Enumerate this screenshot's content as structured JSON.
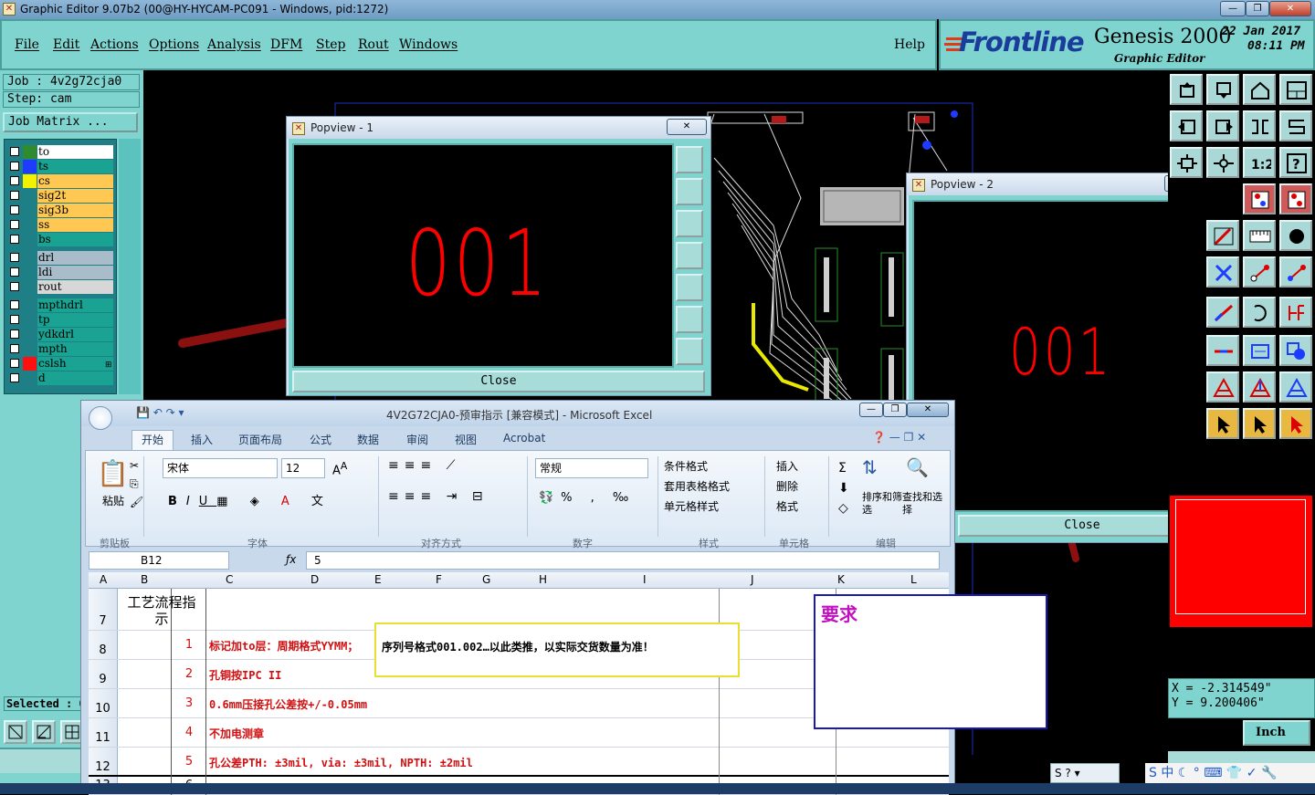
{
  "window": {
    "title": "Graphic Editor 9.07b2 (00@HY-HYCAM-PC091 - Windows, pid:1272)",
    "controls": [
      "—",
      "❐",
      "✕"
    ]
  },
  "menu": [
    "File",
    "Edit",
    "Actions",
    "Options",
    "Analysis",
    "DFM",
    "Step",
    "Rout",
    "Windows"
  ],
  "help": "Help",
  "brand": {
    "logo": "Frontline",
    "product": "Genesis 2000",
    "subtitle": "Graphic Editor",
    "date": "22 Jan 2017",
    "time": "08:11 PM"
  },
  "job": {
    "job_label": "Job : 4v2g72cja0",
    "step_label": "Step: cam",
    "matrix_button": "Job Matrix ..."
  },
  "layers": [
    {
      "name": "to",
      "swatch": "#2e8b2e",
      "bg": "#ffffff"
    },
    {
      "name": "ts",
      "swatch": "#1e3cff",
      "bg": "#1aa392"
    },
    {
      "name": "cs",
      "swatch": "#f2f200",
      "bg": "#ffc852"
    },
    {
      "name": "sig2t",
      "swatch": "",
      "bg": "#ffc852"
    },
    {
      "name": "sig3b",
      "swatch": "",
      "bg": "#ffc852"
    },
    {
      "name": "ss",
      "swatch": "",
      "bg": "#ffc852"
    },
    {
      "name": "bs",
      "swatch": "",
      "bg": "#1aa392"
    },
    {
      "name": "drl",
      "swatch": "",
      "bg": "#a9bcc9"
    },
    {
      "name": "ldi",
      "swatch": "",
      "bg": "#a9bcc9"
    },
    {
      "name": "rout",
      "swatch": "",
      "bg": "#d7d7d7"
    },
    {
      "name": "mpthdrl",
      "swatch": "",
      "bg": "#1aa392"
    },
    {
      "name": "tp",
      "swatch": "",
      "bg": "#1aa392"
    },
    {
      "name": "ydkdrl",
      "swatch": "",
      "bg": "#1aa392"
    },
    {
      "name": "mpth",
      "swatch": "",
      "bg": "#1aa392"
    },
    {
      "name": "cslsh",
      "swatch": "#ff1010",
      "bg": "#1aa392"
    },
    {
      "name": "d",
      "swatch": "",
      "bg": "#1aa392"
    }
  ],
  "selected_label": "Selected : 0",
  "popview1": {
    "title": "Popview - 1",
    "value": "001",
    "close": "Close"
  },
  "popview2": {
    "title": "Popview - 2",
    "value": "001",
    "close": "Close"
  },
  "coords": {
    "x": "X = -2.314549\"",
    "y": "Y = 9.200406\""
  },
  "unit_button": "Inch",
  "excel": {
    "title": "4V2G72CJA0-预审指示 [兼容模式] - Microsoft Excel",
    "tabs": [
      "开始",
      "插入",
      "页面布局",
      "公式",
      "数据",
      "审阅",
      "视图",
      "Acrobat"
    ],
    "groups": [
      "剪贴板",
      "字体",
      "对齐方式",
      "数字",
      "样式",
      "单元格",
      "编辑"
    ],
    "paste": "粘贴",
    "font_name": "宋体",
    "font_size": "12",
    "number_format": "常规",
    "styles": [
      "条件格式",
      "套用表格格式",
      "单元格样式"
    ],
    "cells_ops": [
      "插入",
      "删除",
      "格式"
    ],
    "editing": [
      "排序和筛选",
      "查找和选择"
    ],
    "name_box": "B12",
    "formula_value": "5",
    "columns": [
      "A",
      "B",
      "C",
      "D",
      "E",
      "F",
      "G",
      "H",
      "I",
      "J",
      "K",
      "L"
    ],
    "header_cell": "工艺流程指示",
    "rows": [
      {
        "num": "7",
        "b": "",
        "text": ""
      },
      {
        "num": "8",
        "b": "1",
        "text": "标记加to层：周期格式YYMM；"
      },
      {
        "num": "9",
        "b": "2",
        "text": "孔铜按IPC II"
      },
      {
        "num": "10",
        "b": "3",
        "text": "0.6mm压接孔公差按+/-0.05mm"
      },
      {
        "num": "11",
        "b": "4",
        "text": "不加电测章"
      },
      {
        "num": "12",
        "b": "5",
        "text": "孔公差PTH: ±3mil,  via: ±3mil,  NPTH: ±2mil"
      },
      {
        "num": "13",
        "b": "6",
        "text": ""
      }
    ],
    "callout": "序列号格式001.002…以此类推，以实际交货数量为准！",
    "note_title": "要求"
  },
  "colors": {
    "teal": "#7fd4d0",
    "red": "#ff0000",
    "arrow": "#8b1010"
  }
}
